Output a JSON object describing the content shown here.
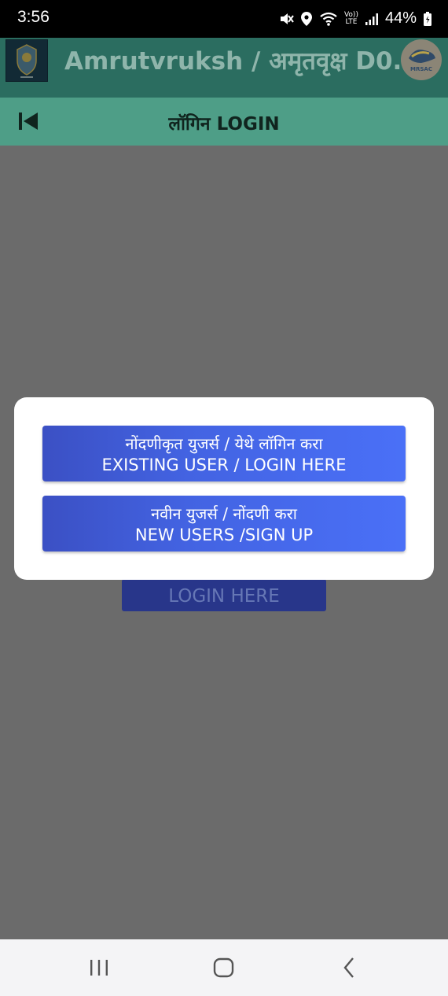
{
  "status_bar": {
    "time": "3:56",
    "lte_top": "Vo))",
    "lte_bottom": "LTE",
    "battery": "44%"
  },
  "app_bar": {
    "title": "Amrutvruksh / अमृतवृक्ष D0.1",
    "right_logo_text": "MRSAC",
    "background": "#2b6d60"
  },
  "sub_header": {
    "title": "लॉगिन  LOGIN",
    "background": "#4e9e87"
  },
  "background_screen": {
    "button_label": "LOGIN HERE"
  },
  "dialog": {
    "existing_user": {
      "line1": "नोंदणीकृत युजर्स / येथे लॉगिन करा",
      "line2": "EXISTING USER / LOGIN HERE"
    },
    "new_user": {
      "line1": "नवीन युजर्स / नोंदणी करा",
      "line2": "NEW USERS /SIGN UP"
    },
    "button_color": "#4363e2"
  },
  "nav_bar": {
    "items": [
      "recent-apps-icon",
      "home-icon",
      "back-icon"
    ]
  }
}
